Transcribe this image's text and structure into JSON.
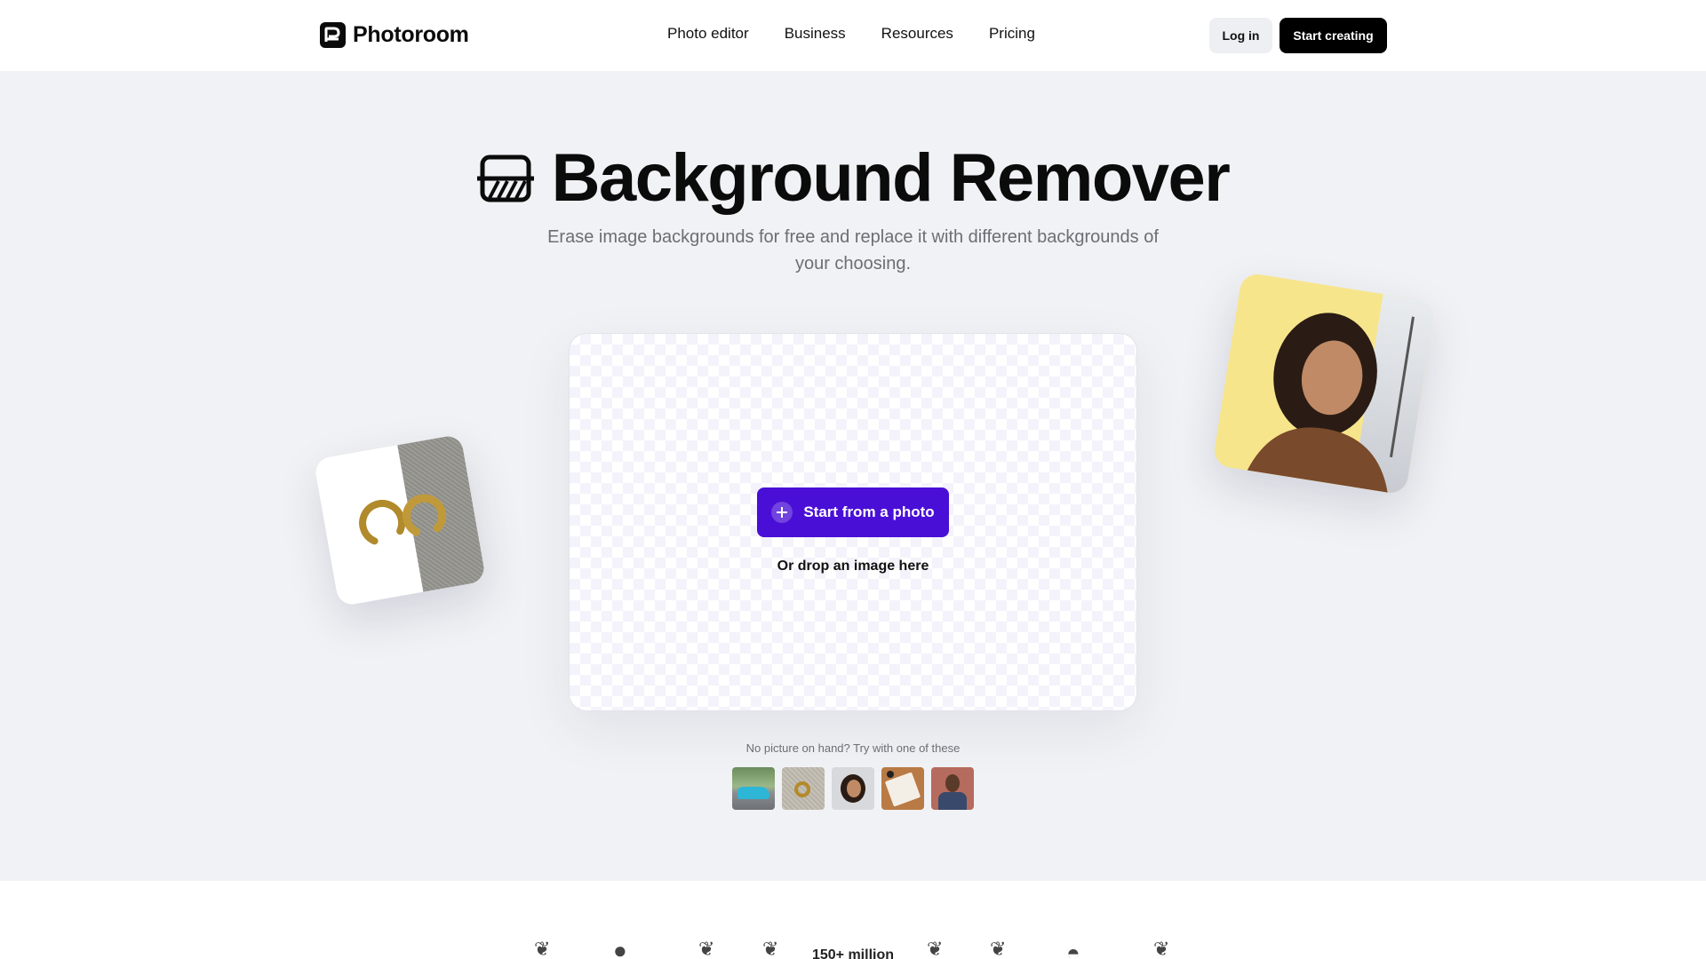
{
  "header": {
    "brand": "Photoroom",
    "nav": [
      "Photo editor",
      "Business",
      "Resources",
      "Pricing"
    ],
    "login_label": "Log in",
    "start_label": "Start creating"
  },
  "hero": {
    "title": "Background Remover",
    "subtitle": "Erase image backgrounds for free and replace it with different backgrounds of your choosing."
  },
  "upload": {
    "button_label": "Start from a photo",
    "drop_text": "Or drop an image here"
  },
  "samples": {
    "label": "No picture on hand? Try with one of these",
    "items": [
      "car-sample",
      "earrings-sample",
      "woman-sample",
      "notebook-sample",
      "man-sample"
    ]
  },
  "stats": {
    "users_label": "150+ million"
  },
  "colors": {
    "accent": "#4a0fd6",
    "page_bg": "#f1f2f5",
    "text_muted": "#6d6d75"
  }
}
